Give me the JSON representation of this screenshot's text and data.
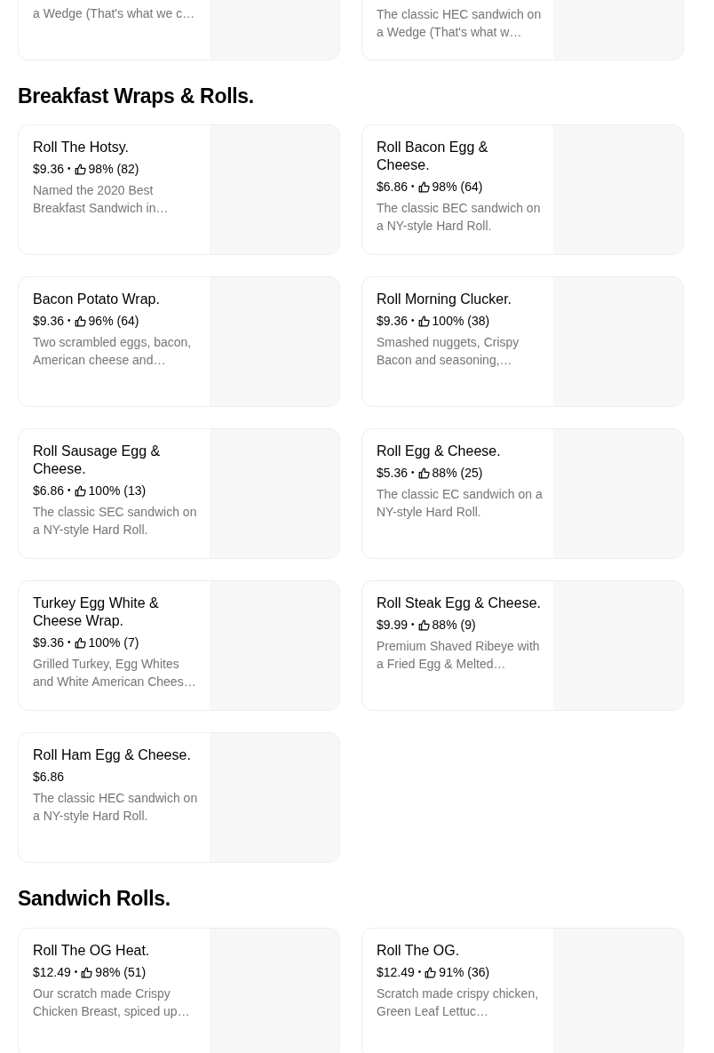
{
  "sections": [
    {
      "items": [
        {
          "description": "a Wedge (That's what we c…"
        },
        {
          "description": "The classic HEC sandwich on a Wedge (That's what w…"
        }
      ]
    },
    {
      "title": "Breakfast Wraps & Rolls.",
      "items": [
        {
          "name": "Roll The Hotsy.",
          "price": "$9.36",
          "separator": "•",
          "rating": "98% (82)",
          "description": "Named the 2020 Best Breakfast Sandwich in…"
        },
        {
          "name": "Roll Bacon Egg & Cheese.",
          "price": "$6.86",
          "separator": "•",
          "rating": "98% (64)",
          "description": "The classic BEC sandwich on a NY-style Hard Roll."
        },
        {
          "name": "Bacon Potato Wrap.",
          "price": "$9.36",
          "separator": "•",
          "rating": "96% (64)",
          "description": "Two scrambled eggs, bacon, American cheese and…"
        },
        {
          "name": "Roll Morning Clucker.",
          "price": "$9.36",
          "separator": "•",
          "rating": "100% (38)",
          "description": "Smashed nuggets, Crispy Bacon and seasoning,…"
        },
        {
          "name": "Roll Sausage Egg & Cheese.",
          "price": "$6.86",
          "separator": "•",
          "rating": "100% (13)",
          "description": "The classic SEC sandwich on a NY-style Hard Roll."
        },
        {
          "name": "Roll Egg & Cheese.",
          "price": "$5.36",
          "separator": "•",
          "rating": "88% (25)",
          "description": "The classic EC sandwich on a NY-style Hard Roll."
        },
        {
          "name": "Turkey Egg White & Cheese Wrap.",
          "price": "$9.36",
          "separator": "•",
          "rating": "100% (7)",
          "description": "Grilled Turkey, Egg Whites and White American Chees…"
        },
        {
          "name": "Roll Steak Egg & Cheese.",
          "price": "$9.99",
          "separator": "•",
          "rating": "88% (9)",
          "description": "Premium Shaved Ribeye with a Fried Egg & Melted…"
        },
        {
          "name": "Roll Ham Egg & Cheese.",
          "price": "$6.86",
          "description": "The classic HEC sandwich on a NY-style Hard Roll."
        }
      ]
    },
    {
      "title": "Sandwich Rolls.",
      "items": [
        {
          "name": "Roll The OG Heat.",
          "price": "$12.49",
          "separator": "•",
          "rating": "98% (51)",
          "description": "Our scratch made Crispy Chicken Breast, spiced up…"
        },
        {
          "name": "Roll The OG.",
          "price": "$12.49",
          "separator": "•",
          "rating": "91% (36)",
          "description": "Scratch made crispy chicken, Green Leaf Lettuc…"
        }
      ]
    }
  ]
}
